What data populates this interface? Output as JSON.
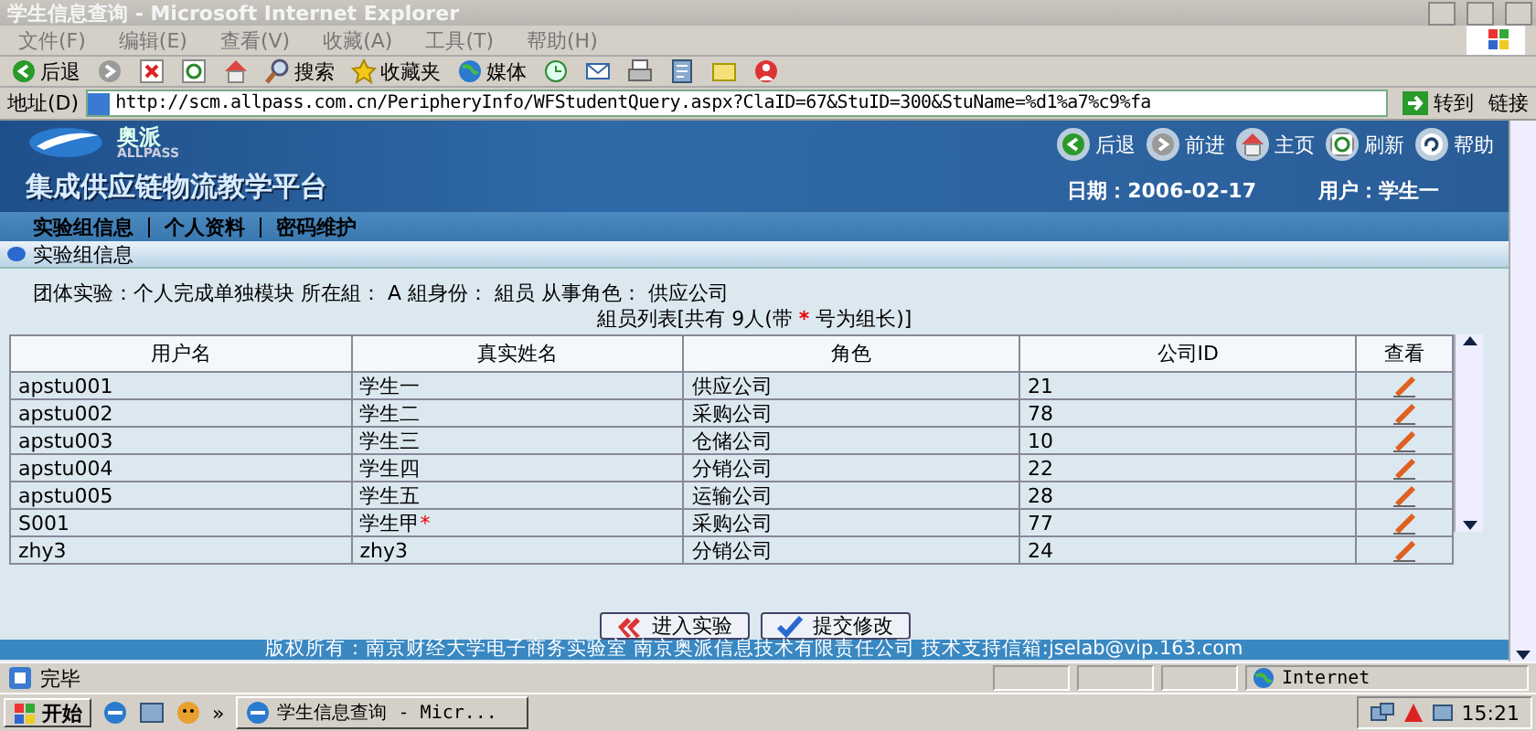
{
  "window": {
    "title": "学生信息查询 - Microsoft Internet Explorer"
  },
  "menu": [
    "文件(F)",
    "编辑(E)",
    "查看(V)",
    "收藏(A)",
    "工具(T)",
    "帮助(H)"
  ],
  "toolbar": [
    {
      "kind": "back",
      "label": "后退"
    },
    {
      "kind": "forward"
    },
    {
      "kind": "stop"
    },
    {
      "kind": "refresh"
    },
    {
      "kind": "home"
    },
    {
      "kind": "search",
      "label": "搜索"
    },
    {
      "kind": "favorites",
      "label": "收藏夹"
    },
    {
      "kind": "media",
      "label": "媒体"
    },
    {
      "kind": "history"
    },
    {
      "kind": "mail"
    },
    {
      "kind": "print"
    },
    {
      "kind": "edit"
    },
    {
      "kind": "note"
    },
    {
      "kind": "messenger"
    }
  ],
  "address": {
    "label": "地址(D)",
    "url": "http://scm.allpass.com.cn/PeripheryInfo/WFStudentQuery.aspx?ClaID=67&StuID=300&StuName=%d1%a7%c9%fa",
    "go": "转到",
    "links": "链接"
  },
  "banner": {
    "brand": "奥派",
    "brand_en": "ALLPASS",
    "title": "集成供应链物流教学平台",
    "date": "日期：2006-02-17",
    "user": "用户：学生一",
    "nav": [
      {
        "kind": "back",
        "label": "后退"
      },
      {
        "kind": "forward",
        "label": "前进"
      },
      {
        "kind": "home",
        "label": "主页"
      },
      {
        "kind": "refresh",
        "label": "刷新"
      },
      {
        "kind": "help",
        "label": "帮助"
      }
    ]
  },
  "tabs": [
    "实验组信息",
    "个人资料",
    "密码维护"
  ],
  "section": "实验组信息",
  "info": "团体实验：个人完成单独模块  所在組：  A  組身份：  組员  从事角色：  供应公司",
  "list_title": {
    "before": "組员列表[共有  9人(带",
    "mark": "*",
    "after": "号为组长)]"
  },
  "table": {
    "columns": [
      "用户名",
      "真实姓名",
      "角色",
      "公司ID",
      "查看"
    ],
    "rows": [
      {
        "user": "apstu001",
        "name": "学生一",
        "role": "供应公司",
        "company_id": "21"
      },
      {
        "user": "apstu002",
        "name": "学生二",
        "role": "采购公司",
        "company_id": "78"
      },
      {
        "user": "apstu003",
        "name": "学生三",
        "role": "仓储公司",
        "company_id": "10"
      },
      {
        "user": "apstu004",
        "name": "学生四",
        "role": "分销公司",
        "company_id": "22"
      },
      {
        "user": "apstu005",
        "name": "学生五",
        "role": "运输公司",
        "company_id": "28"
      },
      {
        "user": "S001",
        "name": "学生甲",
        "mark": "*",
        "role": "采购公司",
        "company_id": "77"
      },
      {
        "user": "zhy3",
        "name": "zhy3",
        "role": "分销公司",
        "company_id": "24"
      }
    ]
  },
  "buttons": [
    {
      "kind": "enter",
      "label": "进入实验"
    },
    {
      "kind": "submit",
      "label": "提交修改"
    }
  ],
  "footer": "版权所有：南京财经大学电子商务实验室 南京奥派信息技术有限责任公司 技术支持信箱:jselab@vip.163.com",
  "status": {
    "text": "完毕",
    "zone": "Internet"
  },
  "taskbar": {
    "start": "开始",
    "more": "»",
    "task": "学生信息查询 - Micr...",
    "clock": "15:21"
  }
}
